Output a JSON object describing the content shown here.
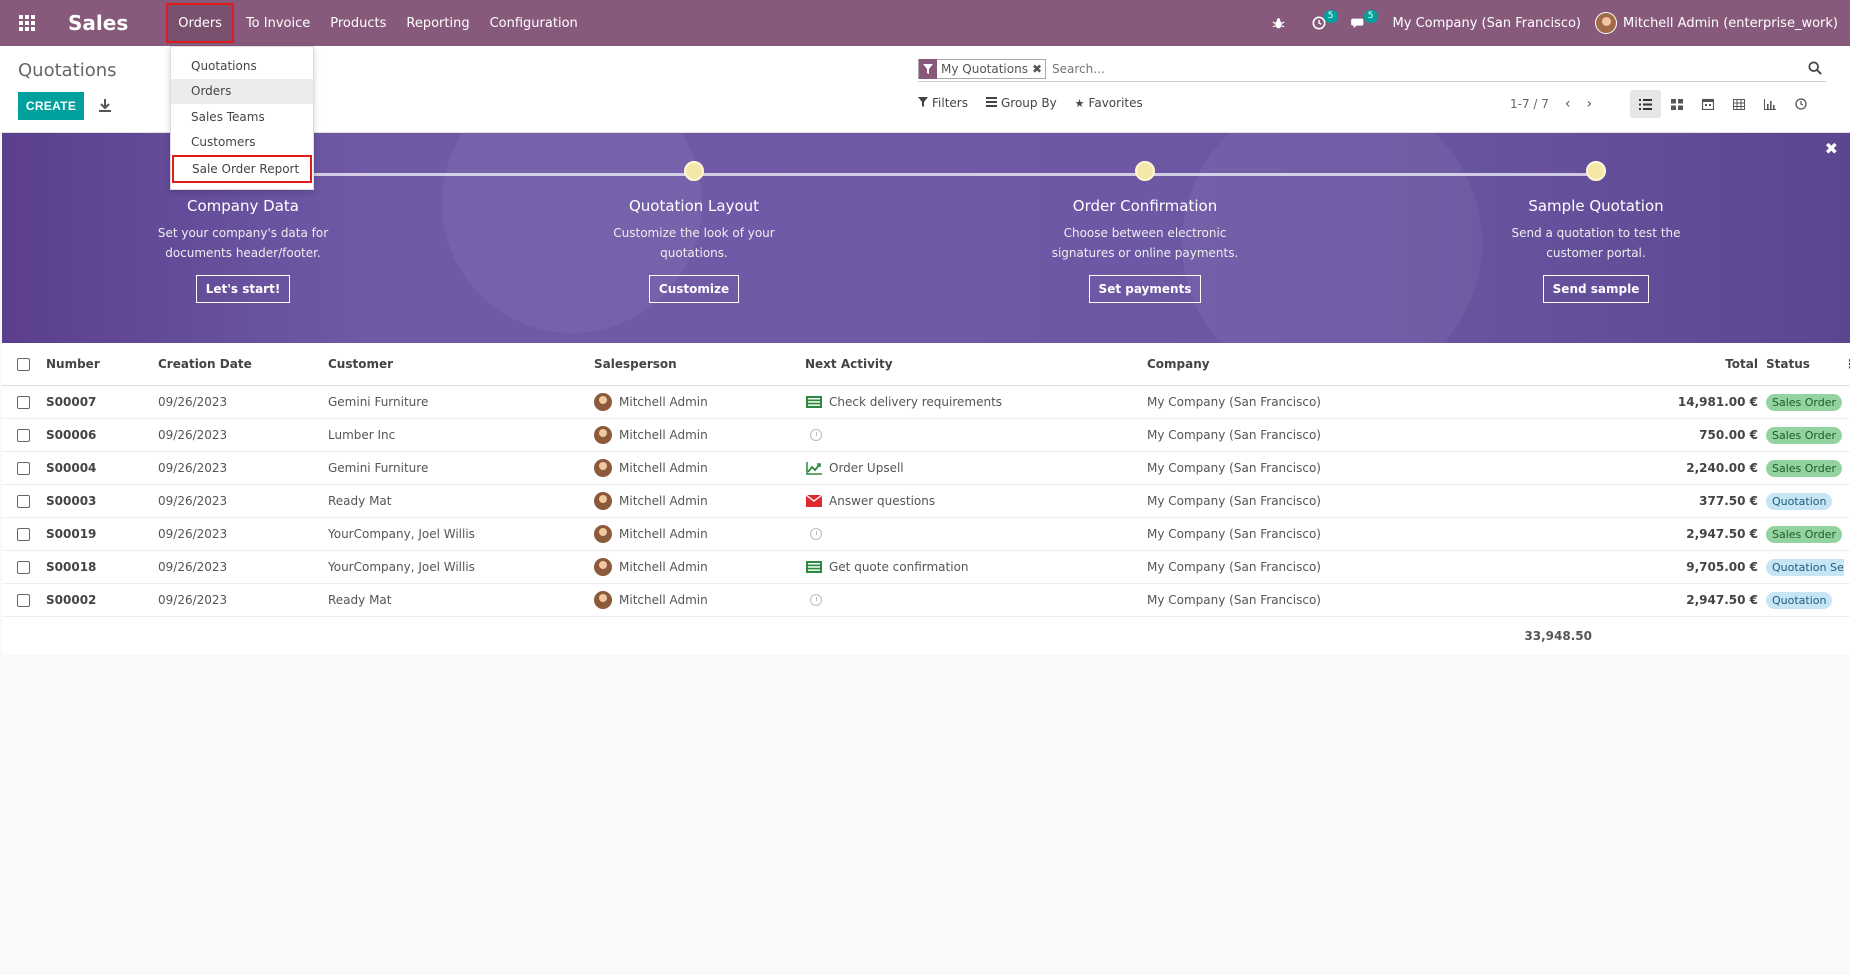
{
  "navbar": {
    "brand": "Sales",
    "menu": [
      "Orders",
      "To Invoice",
      "Products",
      "Reporting",
      "Configuration"
    ],
    "activities_count": "5",
    "messages_count": "5",
    "company": "My Company (San Francisco)",
    "user": "Mitchell Admin (enterprise_work)"
  },
  "dropdown": {
    "items": [
      "Quotations",
      "Orders",
      "Sales Teams",
      "Customers",
      "Sale Order Report"
    ]
  },
  "control": {
    "title": "Quotations",
    "create_label": "CREATE",
    "facet": "My Quotations",
    "search_placeholder": "Search...",
    "filters": "Filters",
    "group_by": "Group By",
    "favorites": "Favorites",
    "pager": "1-7 / 7"
  },
  "banner": {
    "steps": [
      {
        "title": "Company Data",
        "desc1": "Set your company's data for",
        "desc2": "documents header/footer.",
        "button": "Let's start!"
      },
      {
        "title": "Quotation Layout",
        "desc1": "Customize the look of your",
        "desc2": "quotations.",
        "button": "Customize"
      },
      {
        "title": "Order Confirmation",
        "desc1": "Choose between electronic",
        "desc2": "signatures or online payments.",
        "button": "Set payments"
      },
      {
        "title": "Sample Quotation",
        "desc1": "Send a quotation to test the",
        "desc2": "customer portal.",
        "button": "Send sample"
      }
    ]
  },
  "table": {
    "columns": [
      "Number",
      "Creation Date",
      "Customer",
      "Salesperson",
      "Next Activity",
      "Company",
      "Total",
      "Status"
    ],
    "rows": [
      {
        "number": "S00007",
        "date": "09/26/2023",
        "customer": "Gemini Furniture",
        "salesperson": "Mitchell Admin",
        "activity": "Check delivery requirements",
        "activity_icon": "list-icon",
        "company": "My Company (San Francisco)",
        "total": "14,981.00 €",
        "status": "Sales Order"
      },
      {
        "number": "S00006",
        "date": "09/26/2023",
        "customer": "Lumber Inc",
        "salesperson": "Mitchell Admin",
        "activity": "",
        "activity_icon": "clock-icon",
        "company": "My Company (San Francisco)",
        "total": "750.00 €",
        "status": "Sales Order"
      },
      {
        "number": "S00004",
        "date": "09/26/2023",
        "customer": "Gemini Furniture",
        "salesperson": "Mitchell Admin",
        "activity": "Order Upsell",
        "activity_icon": "chart-icon",
        "company": "My Company (San Francisco)",
        "total": "2,240.00 €",
        "status": "Sales Order"
      },
      {
        "number": "S00003",
        "date": "09/26/2023",
        "customer": "Ready Mat",
        "salesperson": "Mitchell Admin",
        "activity": "Answer questions",
        "activity_icon": "email-icon",
        "company": "My Company (San Francisco)",
        "total": "377.50 €",
        "status": "Quotation"
      },
      {
        "number": "S00019",
        "date": "09/26/2023",
        "customer": "YourCompany, Joel Willis",
        "salesperson": "Mitchell Admin",
        "activity": "",
        "activity_icon": "clock-icon",
        "company": "My Company (San Francisco)",
        "total": "2,947.50 €",
        "status": "Sales Order"
      },
      {
        "number": "S00018",
        "date": "09/26/2023",
        "customer": "YourCompany, Joel Willis",
        "salesperson": "Mitchell Admin",
        "activity": "Get quote confirmation",
        "activity_icon": "list-icon",
        "company": "My Company (San Francisco)",
        "total": "9,705.00 €",
        "status": "Quotation Sent"
      },
      {
        "number": "S00002",
        "date": "09/26/2023",
        "customer": "Ready Mat",
        "salesperson": "Mitchell Admin",
        "activity": "",
        "activity_icon": "clock-icon",
        "company": "My Company (San Francisco)",
        "total": "2,947.50 €",
        "status": "Quotation"
      }
    ],
    "grand_total": "33,948.50"
  },
  "colors": {
    "navbar": "#875a7b",
    "primary": "#00a09d",
    "highlight": "#e01b1b",
    "sales_order_badge": "#93d3a0",
    "quotation_badge": "#c7e6f5"
  }
}
